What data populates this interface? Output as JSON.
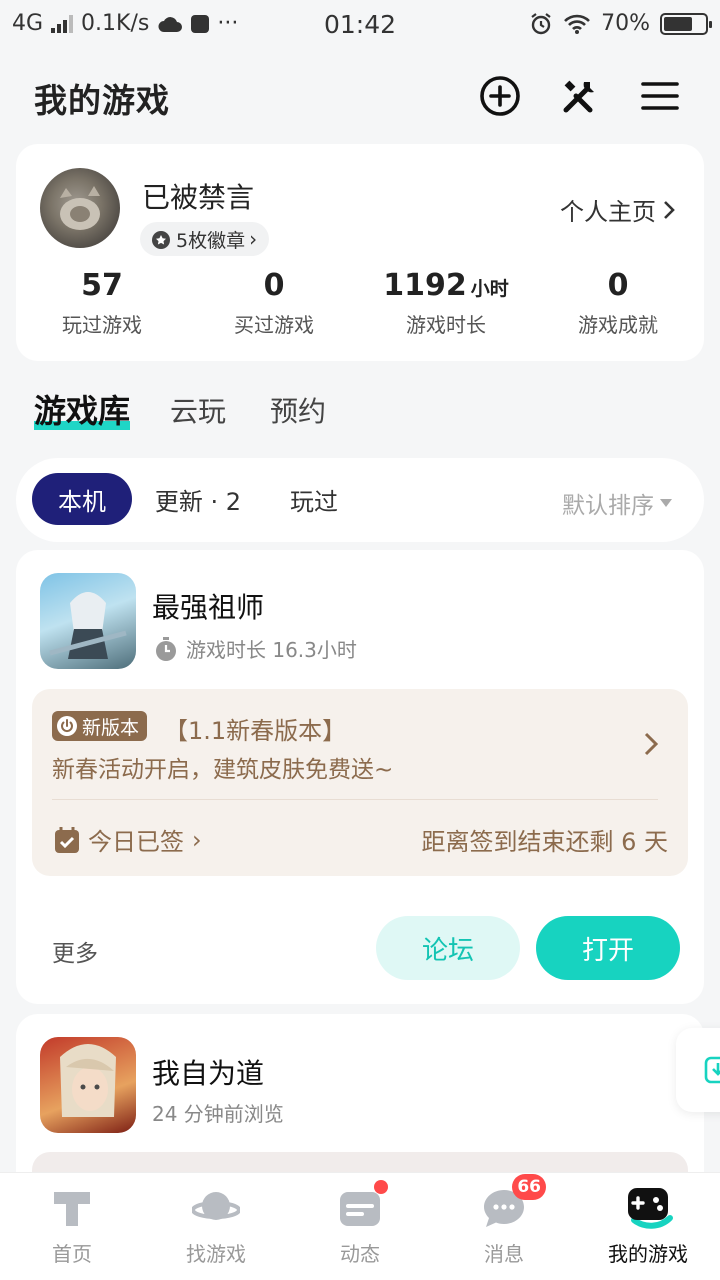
{
  "status_bar": {
    "network": "4G",
    "speed": "0.1K/s",
    "more": "···",
    "time": "01:42",
    "battery": "70%",
    "battery_level": 0.7
  },
  "header": {
    "title": "我的游戏"
  },
  "profile": {
    "name": "已被禁言",
    "badges": "5枚徽章",
    "home_link": "个人主页",
    "stats": [
      {
        "value": "57",
        "unit": "",
        "label": "玩过游戏"
      },
      {
        "value": "0",
        "unit": "",
        "label": "买过游戏"
      },
      {
        "value": "1192",
        "unit": "小时",
        "label": "游戏时长"
      },
      {
        "value": "0",
        "unit": "",
        "label": "游戏成就"
      }
    ]
  },
  "library_tabs": [
    "游戏库",
    "云玩",
    "预约"
  ],
  "filters": {
    "local": "本机",
    "updates": "更新 · 2",
    "played": "玩过",
    "sort": "默认排序"
  },
  "games": [
    {
      "name": "最强祖师",
      "subtitle": "游戏时长 16.3小时",
      "notice_tag": "新版本",
      "notice_title": "【1.1新春版本】",
      "notice_desc": "新春活动开启，建筑皮肤免费送~",
      "sign_status": "今日已签",
      "remain": "距离签到结束还剩 6 天",
      "more": "更多",
      "forum_button": "论坛",
      "open_button": "打开"
    },
    {
      "name": "我自为道",
      "subtitle": "24 分钟前浏览"
    }
  ],
  "bottom_nav": [
    {
      "label": "首页",
      "icon": "home-icon"
    },
    {
      "label": "找游戏",
      "icon": "planet-icon"
    },
    {
      "label": "动态",
      "icon": "feed-icon"
    },
    {
      "label": "消息",
      "icon": "message-icon",
      "badge": "66"
    },
    {
      "label": "我的游戏",
      "icon": "gamepad-icon"
    }
  ],
  "colors": {
    "accent": "#17d3c0",
    "chip_active": "#1f2079",
    "notice_text": "#8c6b4d",
    "badge_red": "#ff4a4a"
  }
}
